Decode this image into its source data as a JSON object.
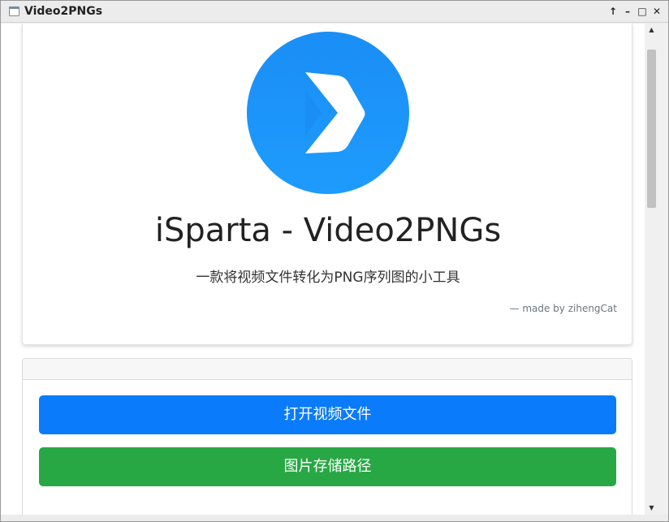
{
  "window": {
    "title": "Video2PNGs",
    "controls": [
      "↑",
      "–",
      "□",
      "✕"
    ]
  },
  "hero": {
    "logo_icon": "chevron-play-icon",
    "title": "iSparta - Video2PNGs",
    "subtitle": "一款将视频文件转化为PNG序列图的小工具",
    "credit": "—  made by zihengCat"
  },
  "actions": {
    "open_video_label": "打开视频文件",
    "save_path_label": "图片存储路径"
  },
  "colors": {
    "primary": "#0a7bfa",
    "success": "#27a844",
    "logo": "#1a8ef5"
  }
}
